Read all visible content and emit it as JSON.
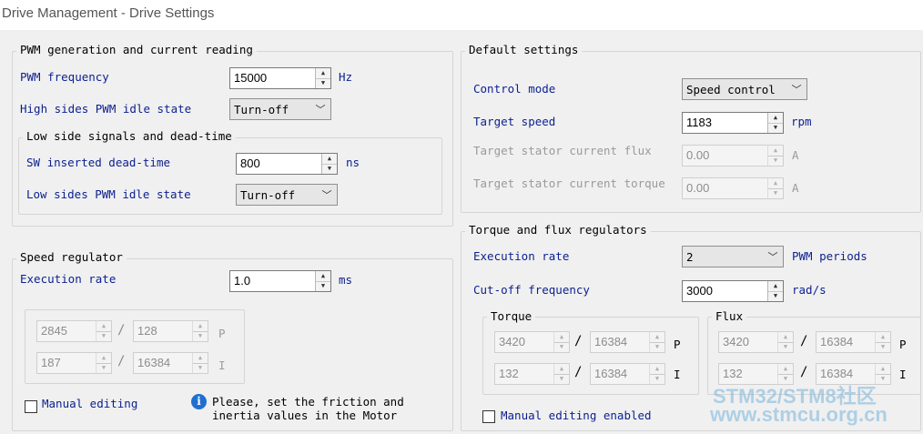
{
  "window": {
    "title": "Drive Management - Drive Settings"
  },
  "pwm_group": {
    "legend": "PWM generation and current reading",
    "pwm_frequency": {
      "label": "PWM frequency",
      "value": "15000",
      "unit": "Hz"
    },
    "high_side_idle": {
      "label": "High sides PWM idle state",
      "selected": "Turn-off"
    },
    "low_side_group": {
      "legend": "Low side signals and dead-time",
      "dead_time": {
        "label": "SW inserted dead-time",
        "value": "800",
        "unit": "ns"
      },
      "low_side_idle": {
        "label": "Low sides PWM idle state",
        "selected": "Turn-off"
      }
    }
  },
  "speed_group": {
    "legend": "Speed regulator",
    "execution_rate": {
      "label": "Execution rate",
      "value": "1.0",
      "unit": "ms"
    },
    "p_row": {
      "num": "2845",
      "den": "128",
      "tag": "P"
    },
    "i_row": {
      "num": "187",
      "den": "16384",
      "tag": "I"
    },
    "manual_editing": "Manual editing",
    "info_line1": "Please, set the friction and",
    "info_line2": "inertia values in the Motor"
  },
  "default_group": {
    "legend": "Default settings",
    "control_mode": {
      "label": "Control mode",
      "selected": "Speed control"
    },
    "target_speed": {
      "label": "Target speed",
      "value": "1183",
      "unit": "rpm"
    },
    "target_flux": {
      "label": "Target stator current flux",
      "value": "0.00",
      "unit": "A"
    },
    "target_torque": {
      "label": "Target stator current torque",
      "value": "0.00",
      "unit": "A"
    }
  },
  "torque_flux_group": {
    "legend": "Torque and flux regulators",
    "execution_rate": {
      "label": "Execution rate",
      "selected": "2",
      "unit": "PWM periods"
    },
    "cutoff": {
      "label": "Cut-off frequency",
      "value": "3000",
      "unit": "rad/s"
    },
    "torque": {
      "legend": "Torque",
      "p_row": {
        "num": "3420",
        "den": "16384",
        "tag": "P"
      },
      "i_row": {
        "num": "132",
        "den": "16384",
        "tag": "I"
      }
    },
    "flux": {
      "legend": "Flux",
      "p_row": {
        "num": "3420",
        "den": "16384",
        "tag": "P"
      },
      "i_row": {
        "num": "132",
        "den": "16384",
        "tag": "I"
      }
    },
    "manual_editing": "Manual editing enabled"
  },
  "watermark": {
    "line1": "STM32/STM8社区",
    "line2": "www.stmcu.org.cn"
  }
}
